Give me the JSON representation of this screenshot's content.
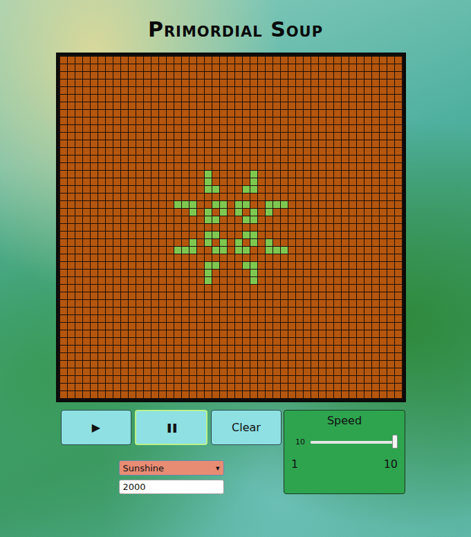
{
  "title": "Primordial Soup",
  "board": {
    "rows": 45,
    "columns": 45,
    "alive": [
      [
        15,
        19
      ],
      [
        15,
        25
      ],
      [
        16,
        19
      ],
      [
        16,
        25
      ],
      [
        17,
        19
      ],
      [
        17,
        20
      ],
      [
        17,
        24
      ],
      [
        17,
        25
      ],
      [
        19,
        15
      ],
      [
        19,
        16
      ],
      [
        19,
        17
      ],
      [
        19,
        20
      ],
      [
        19,
        21
      ],
      [
        19,
        23
      ],
      [
        19,
        24
      ],
      [
        19,
        27
      ],
      [
        19,
        28
      ],
      [
        19,
        29
      ],
      [
        20,
        17
      ],
      [
        20,
        19
      ],
      [
        20,
        21
      ],
      [
        20,
        23
      ],
      [
        20,
        25
      ],
      [
        20,
        27
      ],
      [
        21,
        19
      ],
      [
        21,
        20
      ],
      [
        21,
        24
      ],
      [
        21,
        25
      ],
      [
        23,
        19
      ],
      [
        23,
        20
      ],
      [
        23,
        24
      ],
      [
        23,
        25
      ],
      [
        24,
        17
      ],
      [
        24,
        19
      ],
      [
        24,
        21
      ],
      [
        24,
        23
      ],
      [
        24,
        25
      ],
      [
        24,
        27
      ],
      [
        25,
        15
      ],
      [
        25,
        16
      ],
      [
        25,
        17
      ],
      [
        25,
        20
      ],
      [
        25,
        21
      ],
      [
        25,
        23
      ],
      [
        25,
        24
      ],
      [
        25,
        27
      ],
      [
        25,
        28
      ],
      [
        25,
        29
      ],
      [
        27,
        19
      ],
      [
        27,
        20
      ],
      [
        27,
        24
      ],
      [
        27,
        25
      ],
      [
        28,
        19
      ],
      [
        28,
        25
      ],
      [
        29,
        19
      ],
      [
        29,
        25
      ]
    ]
  },
  "controls": [
    {
      "label": "▶",
      "name": "play",
      "selected": false
    },
    {
      "label": "❚❚",
      "name": "pause",
      "selected": true
    },
    {
      "label": "Clear",
      "name": "clear",
      "selected": false
    }
  ],
  "speed": {
    "title": "Speed",
    "value": "10",
    "level": 1.0,
    "min": "1",
    "max": "10"
  },
  "pattern": {
    "value": "Sunshine",
    "arrow": "▾"
  },
  "generations": {
    "value": "2000"
  }
}
